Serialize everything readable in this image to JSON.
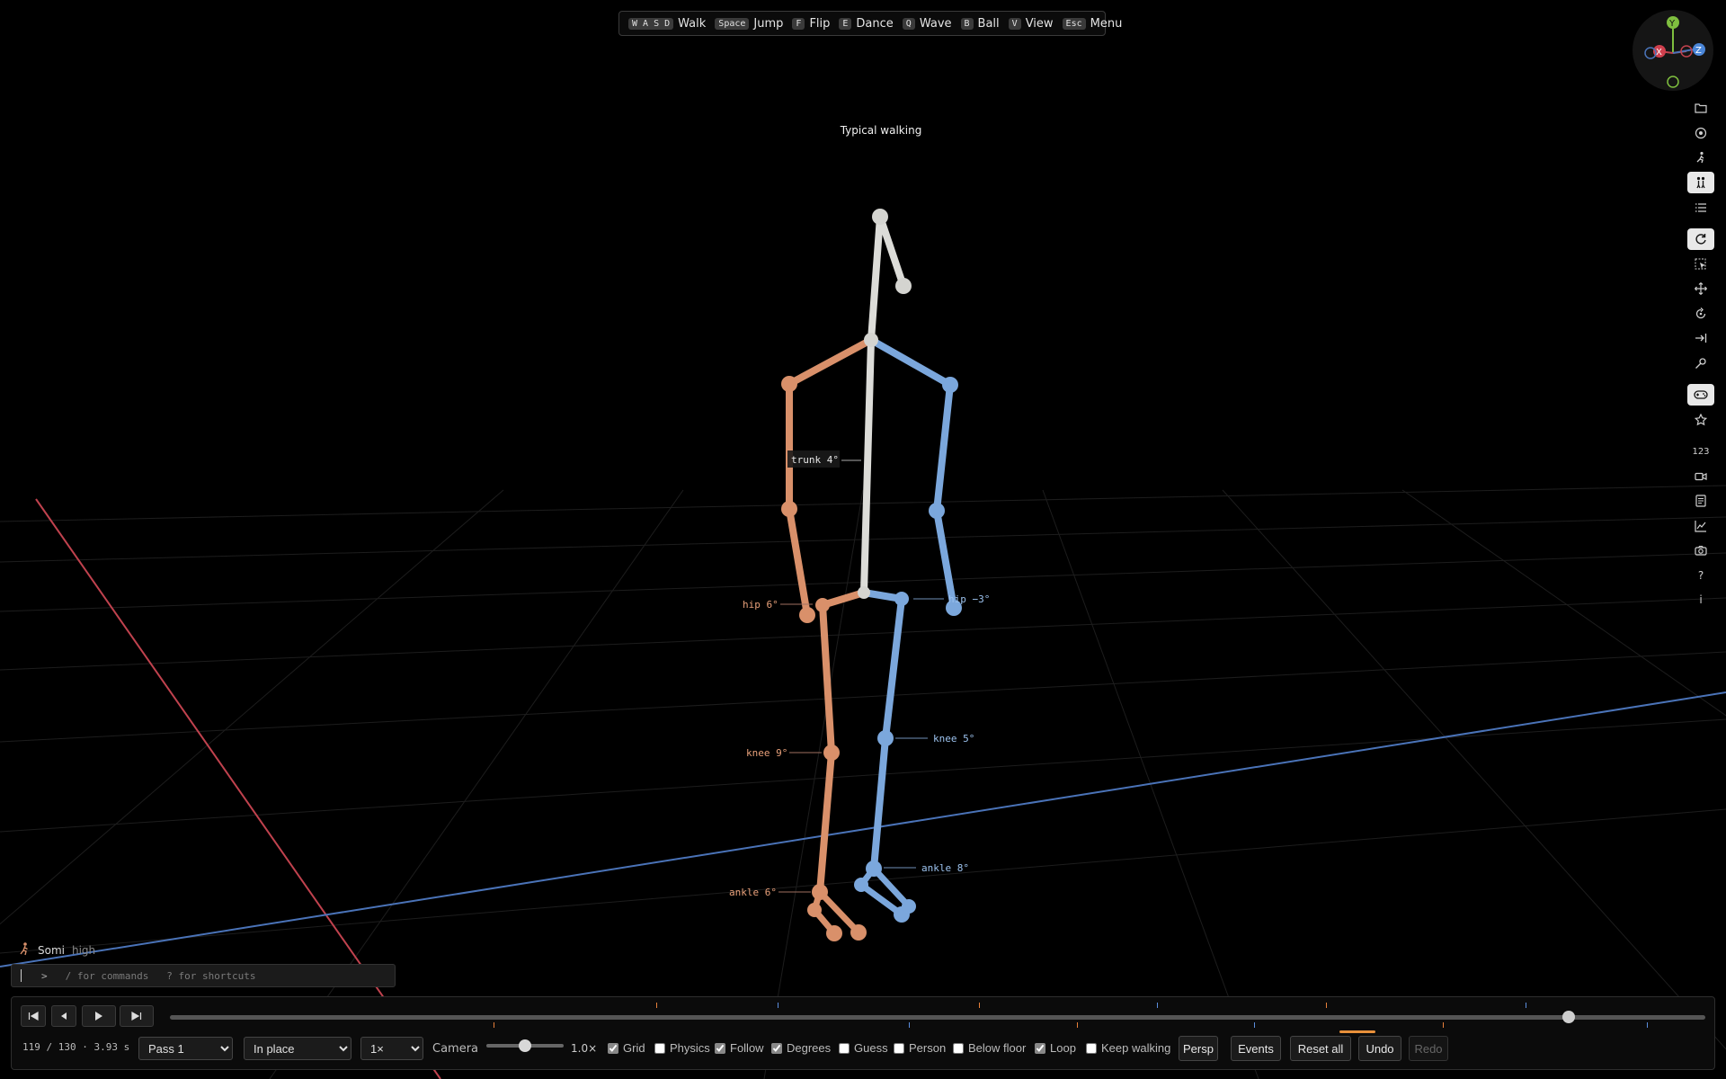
{
  "shortcuts": [
    {
      "keys": "W A S D",
      "label": "Walk"
    },
    {
      "keys": "Space",
      "label": "Jump"
    },
    {
      "keys": "F",
      "label": "Flip"
    },
    {
      "keys": "E",
      "label": "Dance"
    },
    {
      "keys": "Q",
      "label": "Wave"
    },
    {
      "keys": "B",
      "label": "Ball"
    },
    {
      "keys": "V",
      "label": "View"
    },
    {
      "keys": "Esc",
      "label": "Menu"
    }
  ],
  "scene": {
    "title": "Typical walking",
    "angle_labels": {
      "trunk": "trunk 4°",
      "hip_left": "hip 6°",
      "hip_right": "hip −3°",
      "knee_left": "knee 9°",
      "knee_right": "knee 5°",
      "ankle_left": "ankle 6°",
      "ankle_right": "ankle 8°"
    }
  },
  "gizmo": {
    "y": "Y",
    "x": "X",
    "z": "Z"
  },
  "right_toolbar": {
    "numbers_label": "123",
    "help_label": "?",
    "info_label": "i"
  },
  "assistant": {
    "name": "Somi",
    "level": "high"
  },
  "command": {
    "prompt": ">",
    "placeholder": "/ for commands   ? for shortcuts"
  },
  "playback": {
    "frame_text": "119 / 130 · 3.93 s",
    "progress": 0.911,
    "ticks": [
      {
        "pos": 0.317,
        "color": "#e8803a"
      },
      {
        "pos": 0.211,
        "color": "#e8803a"
      },
      {
        "pos": 0.396,
        "color": "#5b8ede"
      },
      {
        "pos": 0.481,
        "color": "#5b8ede"
      },
      {
        "pos": 0.527,
        "color": "#e8803a"
      },
      {
        "pos": 0.591,
        "color": "#e8803a"
      },
      {
        "pos": 0.643,
        "color": "#5b8ede"
      },
      {
        "pos": 0.706,
        "color": "#5b8ede"
      },
      {
        "pos": 0.753,
        "color": "#e8803a"
      },
      {
        "pos": 0.829,
        "color": "#e8803a"
      },
      {
        "pos": 0.883,
        "color": "#5b8ede"
      },
      {
        "pos": 0.962,
        "color": "#5b8ede"
      }
    ]
  },
  "controls": {
    "pass_selected": "Pass 1",
    "mode_selected": "In place",
    "speed_selected": "1×",
    "camera_label": "Camera",
    "camera_value_text": "1.0×",
    "camera_level": 0.5
  },
  "toggles": {
    "grid": {
      "label": "Grid",
      "checked": true
    },
    "physics": {
      "label": "Physics",
      "checked": false
    },
    "follow": {
      "label": "Follow",
      "checked": true
    },
    "degrees": {
      "label": "Degrees",
      "checked": true
    },
    "guess": {
      "label": "Guess",
      "checked": false
    },
    "person": {
      "label": "Person",
      "checked": false
    },
    "below_floor": {
      "label": "Below floor",
      "checked": false
    },
    "loop": {
      "label": "Loop",
      "checked": true
    },
    "keep_walking": {
      "label": "Keep walking",
      "checked": false
    }
  },
  "buttons": {
    "persp": "Persp",
    "events": "Events",
    "reset_all": "Reset all",
    "undo": "Undo",
    "redo": "Redo"
  },
  "colors": {
    "left_limb": "#d9906a",
    "right_limb": "#7ba7dc",
    "trunk": "#dcdcd8",
    "x_axis": "#c0424e",
    "z_axis": "#4a73b8",
    "accent": "#e8903a"
  }
}
